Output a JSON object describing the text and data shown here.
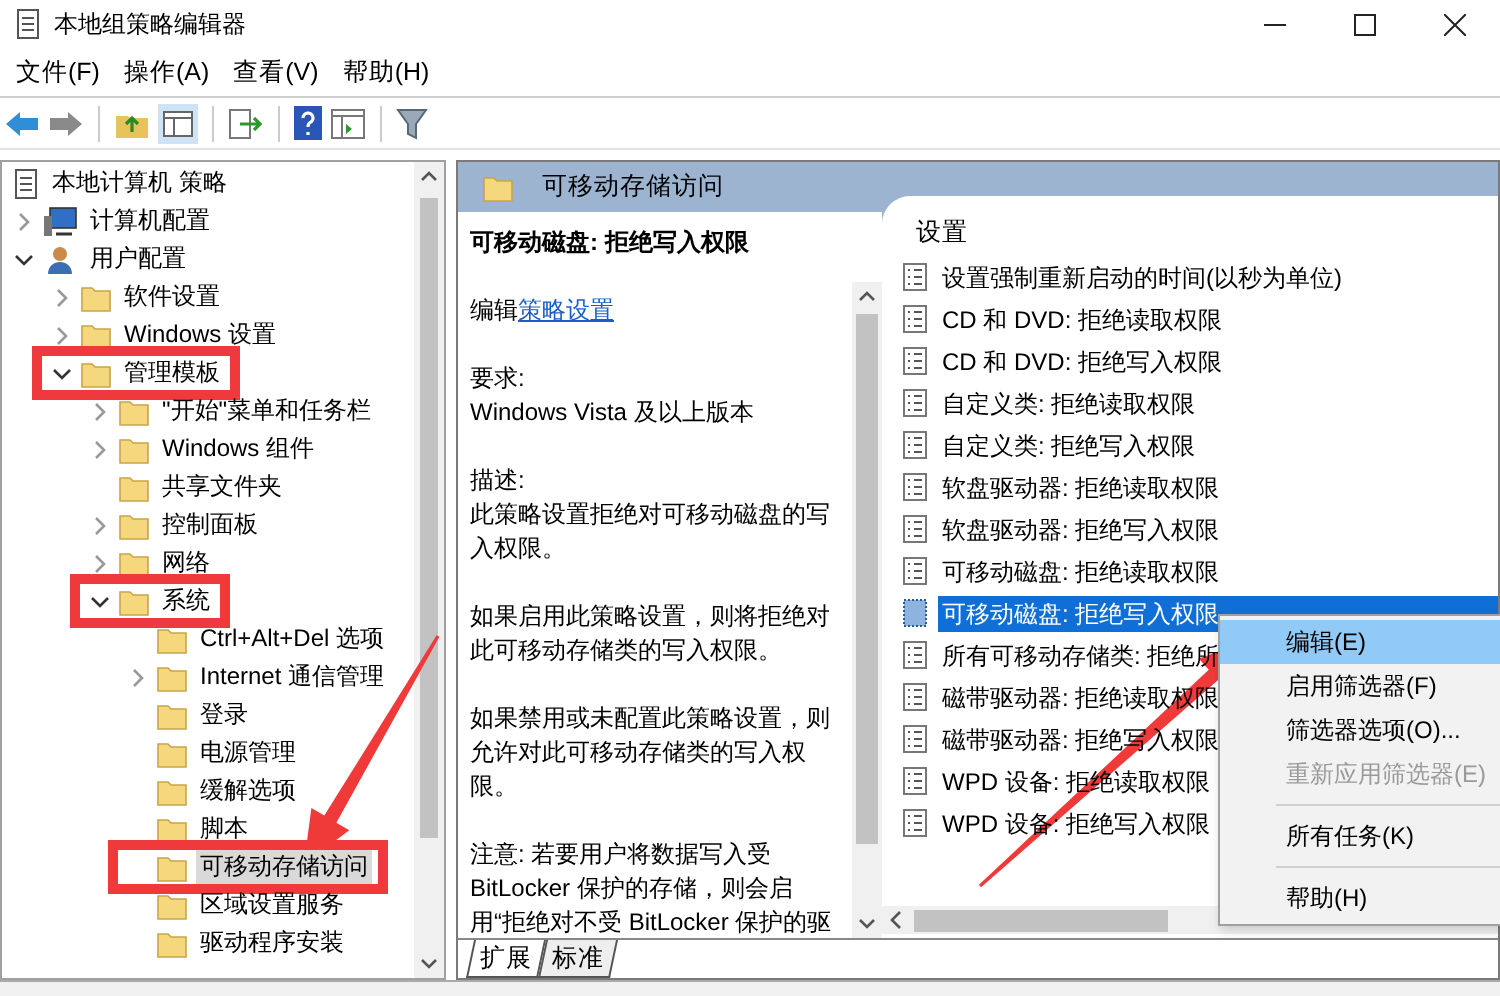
{
  "window": {
    "title": "本地组策略编辑器"
  },
  "menu": [
    "文件(F)",
    "操作(A)",
    "查看(V)",
    "帮助(H)"
  ],
  "tree": [
    {
      "label": "本地计算机 策略",
      "kind": "policy",
      "selected": false,
      "highlighted": false,
      "children": [
        {
          "label": "计算机配置",
          "kind": "computer",
          "expandable": true,
          "expanded": false,
          "selected": false,
          "highlighted": false
        },
        {
          "label": "用户配置",
          "kind": "user",
          "expandable": true,
          "expanded": true,
          "selected": false,
          "highlighted": false,
          "children": [
            {
              "label": "软件设置",
              "kind": "folder",
              "expandable": true,
              "expanded": false,
              "selected": false,
              "highlighted": false
            },
            {
              "label": "Windows 设置",
              "kind": "folder",
              "expandable": true,
              "expanded": false,
              "selected": false,
              "highlighted": false
            },
            {
              "label": "管理模板",
              "kind": "folder",
              "expandable": true,
              "expanded": true,
              "selected": false,
              "highlighted": true,
              "children": [
                {
                  "label": "\"开始\"菜单和任务栏",
                  "kind": "folder",
                  "expandable": true,
                  "expanded": false,
                  "selected": false,
                  "highlighted": false
                },
                {
                  "label": "Windows 组件",
                  "kind": "folder",
                  "expandable": true,
                  "expanded": false,
                  "selected": false,
                  "highlighted": false
                },
                {
                  "label": "共享文件夹",
                  "kind": "folder",
                  "expandable": false,
                  "selected": false,
                  "highlighted": false
                },
                {
                  "label": "控制面板",
                  "kind": "folder",
                  "expandable": true,
                  "expanded": false,
                  "selected": false,
                  "highlighted": false
                },
                {
                  "label": "网络",
                  "kind": "folder",
                  "expandable": true,
                  "expanded": false,
                  "selected": false,
                  "highlighted": false
                },
                {
                  "label": "系统",
                  "kind": "folder",
                  "expandable": true,
                  "expanded": true,
                  "selected": false,
                  "highlighted": true,
                  "children": [
                    {
                      "label": "Ctrl+Alt+Del 选项",
                      "kind": "folder",
                      "expandable": false,
                      "selected": false,
                      "highlighted": false
                    },
                    {
                      "label": "Internet 通信管理",
                      "kind": "folder",
                      "expandable": true,
                      "expanded": false,
                      "selected": false,
                      "highlighted": false
                    },
                    {
                      "label": "登录",
                      "kind": "folder",
                      "expandable": false,
                      "selected": false,
                      "highlighted": false
                    },
                    {
                      "label": "电源管理",
                      "kind": "folder",
                      "expandable": false,
                      "selected": false,
                      "highlighted": false
                    },
                    {
                      "label": "缓解选项",
                      "kind": "folder",
                      "expandable": false,
                      "selected": false,
                      "highlighted": false
                    },
                    {
                      "label": "脚本",
                      "kind": "folder",
                      "expandable": false,
                      "selected": false,
                      "highlighted": false
                    },
                    {
                      "label": "可移动存储访问",
                      "kind": "folder",
                      "expandable": false,
                      "selected": true,
                      "highlighted": true
                    },
                    {
                      "label": "区域设置服务",
                      "kind": "folder",
                      "expandable": false,
                      "selected": false,
                      "highlighted": false
                    },
                    {
                      "label": "驱动程序安装",
                      "kind": "folder",
                      "expandable": false,
                      "selected": false,
                      "highlighted": false
                    }
                  ]
                }
              ]
            }
          ]
        }
      ]
    }
  ],
  "header": {
    "title": "可移动存储访问"
  },
  "description": {
    "title": "可移动磁盘: 拒绝写入权限",
    "edit_prefix": "编辑",
    "edit_link": "策略设置",
    "requirements_label": "要求:",
    "requirements": "Windows Vista 及以上版本",
    "description_label": "描述:",
    "paragraphs": [
      "此策略设置拒绝对可移动磁盘的写入权限。",
      "如果启用此策略设置，则将拒绝对此可移动存储类的写入权限。",
      "如果禁用或未配置此策略设置，则允许对此可移动存储类的写入权限。",
      "注意: 若要用户将数据写入受 BitLocker 保护的存储，则会启用“拒绝对不受 BitLocker 保护的驱"
    ]
  },
  "settings": {
    "column": "设置",
    "items": [
      {
        "label": "设置强制重新启动的时间(以秒为单位)",
        "selected": false
      },
      {
        "label": "CD 和 DVD: 拒绝读取权限",
        "selected": false
      },
      {
        "label": "CD 和 DVD: 拒绝写入权限",
        "selected": false
      },
      {
        "label": "自定义类: 拒绝读取权限",
        "selected": false
      },
      {
        "label": "自定义类: 拒绝写入权限",
        "selected": false
      },
      {
        "label": "软盘驱动器: 拒绝读取权限",
        "selected": false
      },
      {
        "label": "软盘驱动器: 拒绝写入权限",
        "selected": false
      },
      {
        "label": "可移动磁盘: 拒绝读取权限",
        "selected": false
      },
      {
        "label": "可移动磁盘: 拒绝写入权限",
        "selected": true
      },
      {
        "label": "所有可移动存储类: 拒绝所",
        "selected": false
      },
      {
        "label": "磁带驱动器: 拒绝读取权限",
        "selected": false
      },
      {
        "label": "磁带驱动器: 拒绝写入权限",
        "selected": false
      },
      {
        "label": "WPD 设备: 拒绝读取权限",
        "selected": false
      },
      {
        "label": "WPD 设备: 拒绝写入权限",
        "selected": false
      }
    ]
  },
  "view_tabs": [
    {
      "label": "扩展",
      "selected": true
    },
    {
      "label": "标准",
      "selected": false
    }
  ],
  "context_menu": [
    {
      "kind": "item",
      "label": "编辑(E)",
      "highlighted": true,
      "disabled": false
    },
    {
      "kind": "item",
      "label": "启用筛选器(F)",
      "highlighted": false,
      "disabled": false
    },
    {
      "kind": "item",
      "label": "筛选器选项(O)...",
      "highlighted": false,
      "disabled": false
    },
    {
      "kind": "item",
      "label": "重新应用筛选器(E)",
      "highlighted": false,
      "disabled": true
    },
    {
      "kind": "separator"
    },
    {
      "kind": "item",
      "label": "所有任务(K)",
      "highlighted": false,
      "disabled": false
    },
    {
      "kind": "separator"
    },
    {
      "kind": "item",
      "label": "帮助(H)",
      "highlighted": false,
      "disabled": false
    }
  ]
}
